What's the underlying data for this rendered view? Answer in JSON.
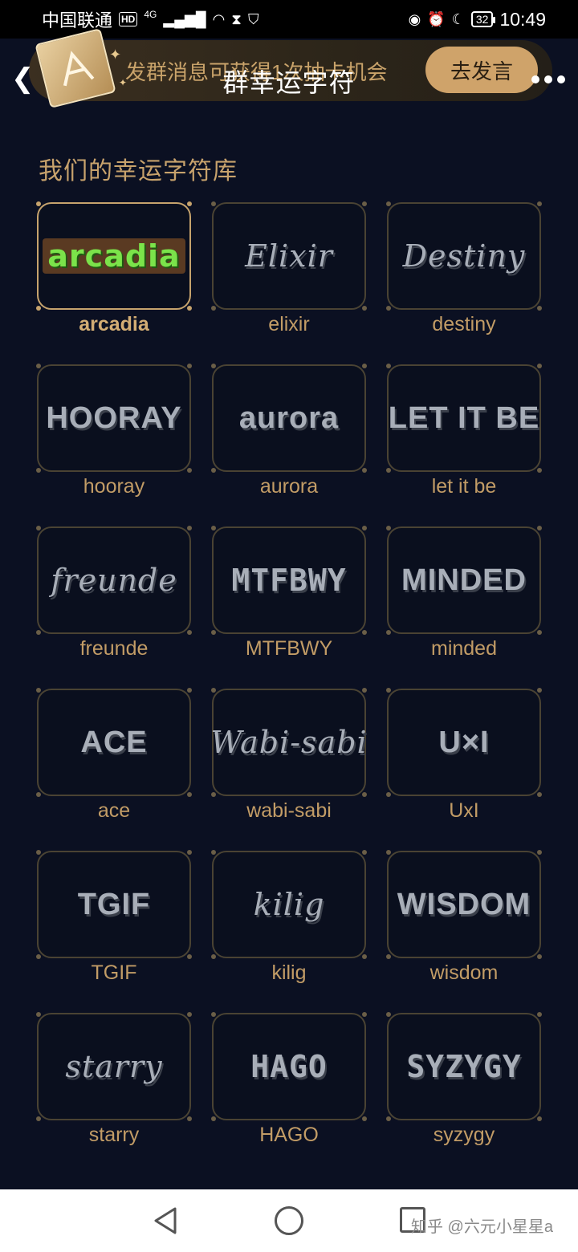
{
  "status_bar": {
    "carrier": "中国联通",
    "hd": "HD",
    "network": "4G",
    "battery": "32",
    "time": "10:49"
  },
  "header": {
    "title": "群幸运字符",
    "promo_text": "发群消息可获得1次抽卡机会",
    "promo_button": "去发言"
  },
  "section": {
    "title": "我们的幸运字符库"
  },
  "cards": [
    {
      "label": "arcadia",
      "art": "arcadia",
      "selected": true
    },
    {
      "label": "elixir",
      "art": "Elixir"
    },
    {
      "label": "destiny",
      "art": "Destiny"
    },
    {
      "label": "hooray",
      "art": "HOORAY"
    },
    {
      "label": "aurora",
      "art": "aurora"
    },
    {
      "label": "let it be",
      "art": "LET IT BE"
    },
    {
      "label": "freunde",
      "art": "freunde"
    },
    {
      "label": "MTFBWY",
      "art": "MTFBWY"
    },
    {
      "label": "minded",
      "art": "MINDED"
    },
    {
      "label": "ace",
      "art": "ACE"
    },
    {
      "label": "wabi-sabi",
      "art": "Wabi-sabi"
    },
    {
      "label": "UxI",
      "art": "U×I"
    },
    {
      "label": "TGIF",
      "art": "TGIF"
    },
    {
      "label": "kilig",
      "art": "kilig"
    },
    {
      "label": "wisdom",
      "art": "WISDOM"
    },
    {
      "label": "starry",
      "art": "starry"
    },
    {
      "label": "HAGO",
      "art": "HAGO"
    },
    {
      "label": "syzygy",
      "art": "SYZYGY"
    }
  ],
  "watermark": "知乎 @六元小星星a",
  "colors": {
    "background": "#0b1022",
    "accent_gold": "#c7a26c",
    "card_border": "#4a4333",
    "selected_border": "#c6a36d",
    "promo_button_bg": "#cfa36a"
  }
}
